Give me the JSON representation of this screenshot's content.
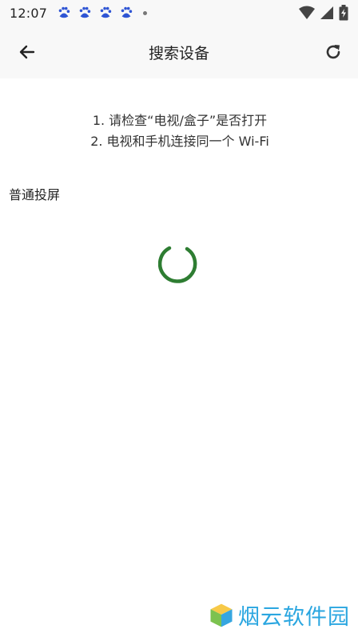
{
  "status_bar": {
    "time": "12:07",
    "notifications": [
      "baidu-paw-icon",
      "baidu-paw-icon",
      "baidu-paw-icon",
      "baidu-paw-icon"
    ],
    "icons": [
      "wifi-icon",
      "cellular-signal-icon",
      "battery-charging-icon"
    ]
  },
  "app_bar": {
    "title": "搜索设备",
    "back_icon": "arrow-left-icon",
    "refresh_icon": "refresh-icon"
  },
  "instructions": {
    "line1": "1. 请检查“电视/盒子”是否打开",
    "line2": "2. 电视和手机连接同一个 Wi-Fi"
  },
  "section": {
    "label": "普通投屏"
  },
  "loading": {
    "accent_color": "#2e7d32"
  },
  "watermark": {
    "text": "烟云软件园",
    "color": "#2aa6e0"
  }
}
